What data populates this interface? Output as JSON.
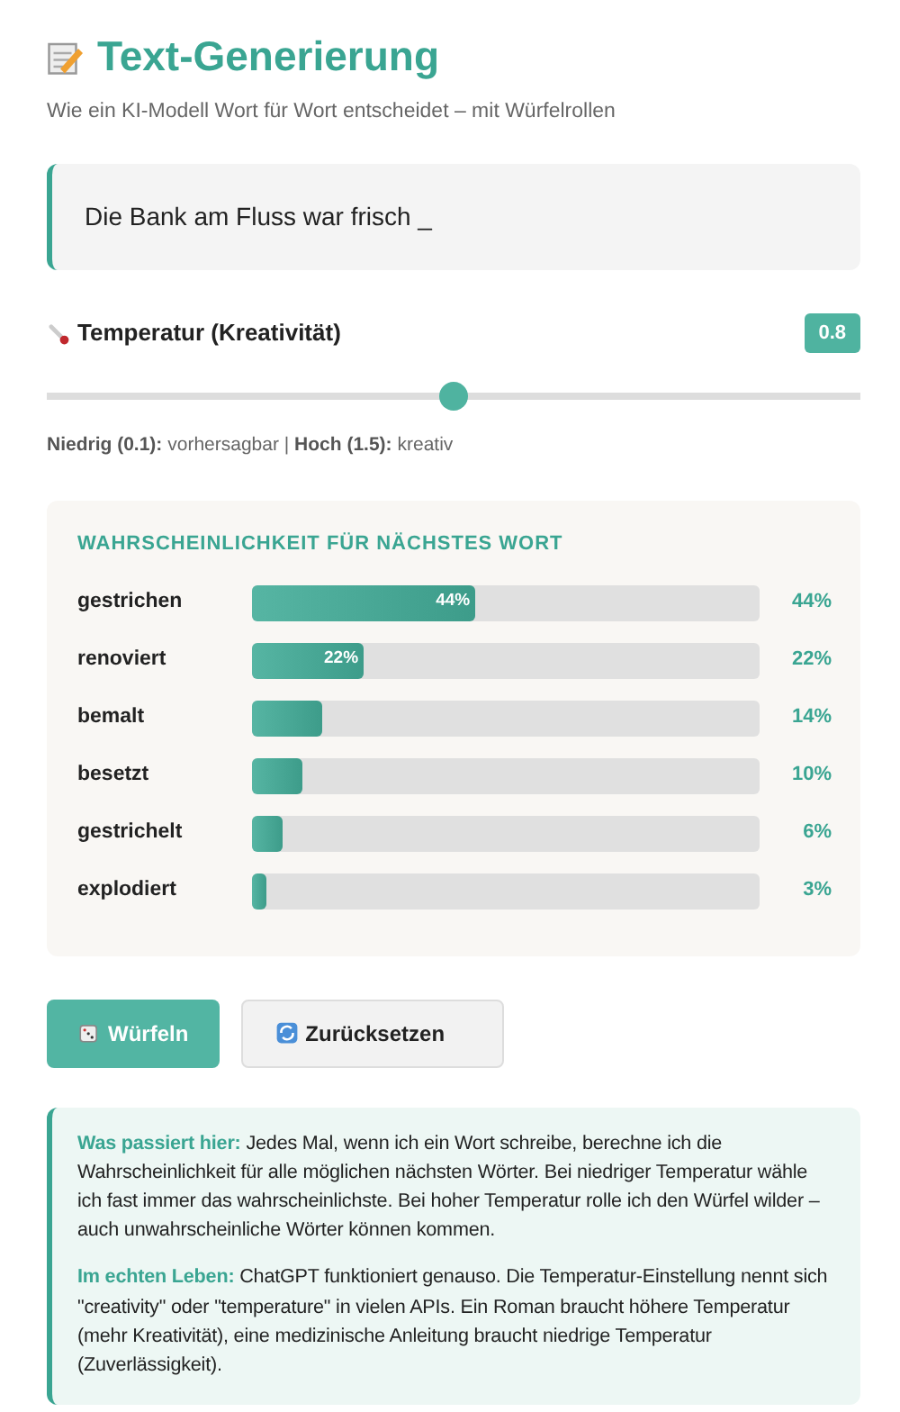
{
  "title": "Text-Generierung",
  "subtitle": "Wie ein KI-Modell Wort für Wort entscheidet – mit Würfelrollen",
  "prompt": "Die Bank am Fluss war frisch _",
  "temperature": {
    "label": "Temperatur (Kreativität)",
    "value": "0.8",
    "level": 0.5,
    "hint": [
      {
        "bold": "Niedrig (0.1):",
        "text": " vorhersagbar"
      },
      {
        "sep": " | "
      },
      {
        "bold": "Hoch (1.5):",
        "text": " kreativ"
      }
    ]
  },
  "probabilities": {
    "heading": "WAHRSCHEINLICHKEIT FÜR NÄCHSTES WORT",
    "rows": [
      {
        "word": "gestrichen",
        "level": 0.44,
        "bar_label": "44%",
        "percent": "44%"
      },
      {
        "word": "renoviert",
        "level": 0.22,
        "bar_label": "22%",
        "percent": "22%"
      },
      {
        "word": "bemalt",
        "level": 0.14,
        "percent": "14%"
      },
      {
        "word": "besetzt",
        "level": 0.1,
        "percent": "10%"
      },
      {
        "word": "gestrichelt",
        "level": 0.06,
        "percent": "6%"
      },
      {
        "word": "explodiert",
        "level": 0.03,
        "percent": "3%"
      }
    ]
  },
  "buttons": [
    {
      "label": "Würfeln",
      "kind": "primary"
    },
    {
      "label": "Zurücksetzen",
      "kind": "secondary"
    }
  ],
  "info": [
    {
      "lead": "Was passiert hier:",
      "text": " Jedes Mal, wenn ich ein Wort schreibe, berechne ich die Wahrscheinlichkeit für alle möglichen nächsten Wörter. Bei niedriger Temperatur wähle ich fast immer das wahrscheinlichste. Bei hoher Temperatur rolle ich den Würfel wilder – auch unwahrscheinliche Wörter können kommen."
    },
    {
      "lead": "Im echten Leben:",
      "text": " ChatGPT funktioniert genauso. Die Temperatur-Einstellung nennt sich \"creativity\" oder \"temperature\" in vielen APIs. Ein Roman braucht höhere Temperatur (mehr Kreativität), eine medizinische Anleitung braucht niedrige Temperatur (Zuverlässigkeit)."
    }
  ]
}
